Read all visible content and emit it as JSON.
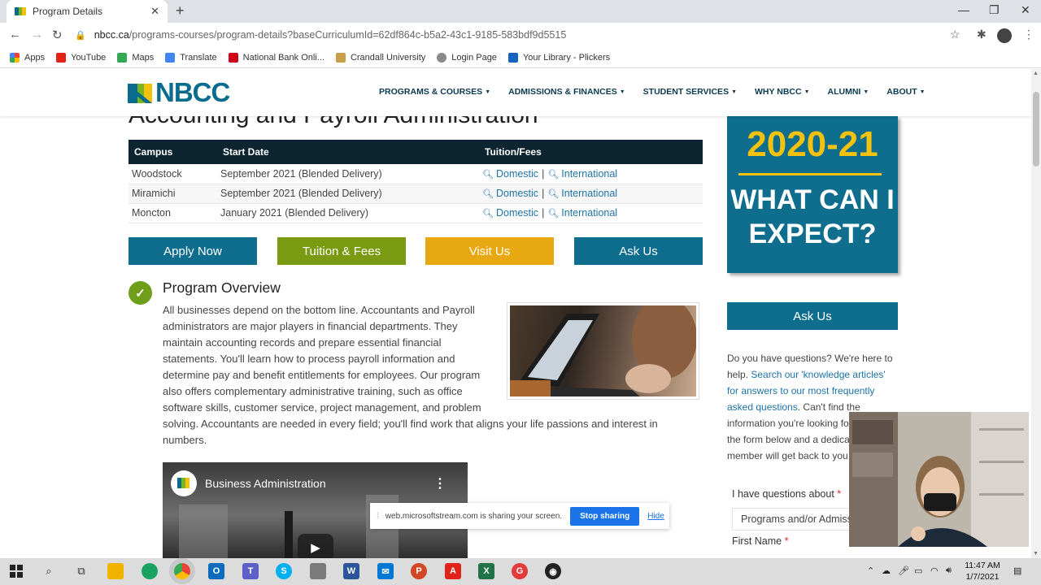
{
  "browser": {
    "tab_title": "Program Details",
    "url_host": "nbcc.ca",
    "url_path": "/programs-courses/program-details?baseCurriculumId=62df864c-b5a2-43c1-9185-583bdf9d5515",
    "bookmarks": [
      "Apps",
      "YouTube",
      "Maps",
      "Translate",
      "National Bank Onli...",
      "Crandall University",
      "Login Page",
      "Your Library - Plickers"
    ]
  },
  "header": {
    "logo_text": "NBCC",
    "nav": [
      "PROGRAMS & COURSES",
      "ADMISSIONS & FINANCES",
      "STUDENT SERVICES",
      "WHY NBCC",
      "ALUMNI",
      "ABOUT"
    ]
  },
  "program": {
    "title": "Accounting and Payroll Administration",
    "table": {
      "headers": [
        "Campus",
        "Start Date",
        "Tuition/Fees"
      ],
      "rows": [
        {
          "campus": "Woodstock",
          "start": "September 2021 (Blended Delivery)",
          "domestic": "Domestic",
          "international": "International"
        },
        {
          "campus": "Miramichi",
          "start": "September 2021 (Blended Delivery)",
          "domestic": "Domestic",
          "international": "International"
        },
        {
          "campus": "Moncton",
          "start": "January 2021 (Blended Delivery)",
          "domestic": "Domestic",
          "international": "International"
        }
      ],
      "separator": "|"
    },
    "buttons": {
      "apply": "Apply Now",
      "tuition": "Tuition & Fees",
      "visit": "Visit Us",
      "ask": "Ask Us"
    },
    "button_colors": {
      "apply": "#0f6d8e",
      "tuition": "#7a9a12",
      "visit": "#e8a811",
      "ask": "#0f6d8e"
    },
    "overview": {
      "heading": "Program Overview",
      "body": "All businesses depend on the bottom line. Accountants and Payroll administrators are major players in financial departments. They maintain accounting records and prepare essential financial statements. You'll learn how to process payroll information and determine pay and benefit entitlements for employees. Our program also offers complementary administrative training, such as office software skills, customer service, project management, and problem solving. Accountants are needed in every field; you'll find work that aligns your life passions and interest in numbers."
    },
    "video": {
      "title": "Business Administration"
    }
  },
  "share_bar": {
    "message": "web.microsoftstream.com is sharing your screen.",
    "stop": "Stop sharing",
    "hide": "Hide"
  },
  "sidebar": {
    "promo_year": "2020-21",
    "promo_question": "WHAT CAN I EXPECT?",
    "ask_button": "Ask Us",
    "text_1": "Do you have questions? We're here to help. ",
    "link": "Search our 'knowledge articles' for answers to our most frequently asked questions",
    "text_2": ". Can't find the information you're looking for? Fill out the form below and a dedicated staff member will get back to you.",
    "q_label": "I have questions about",
    "q_select": "Programs and/or Admissions",
    "first_name_label": "First Name",
    "required": "*"
  },
  "taskbar": {
    "time": "11:47 AM",
    "date": "1/7/2021"
  }
}
